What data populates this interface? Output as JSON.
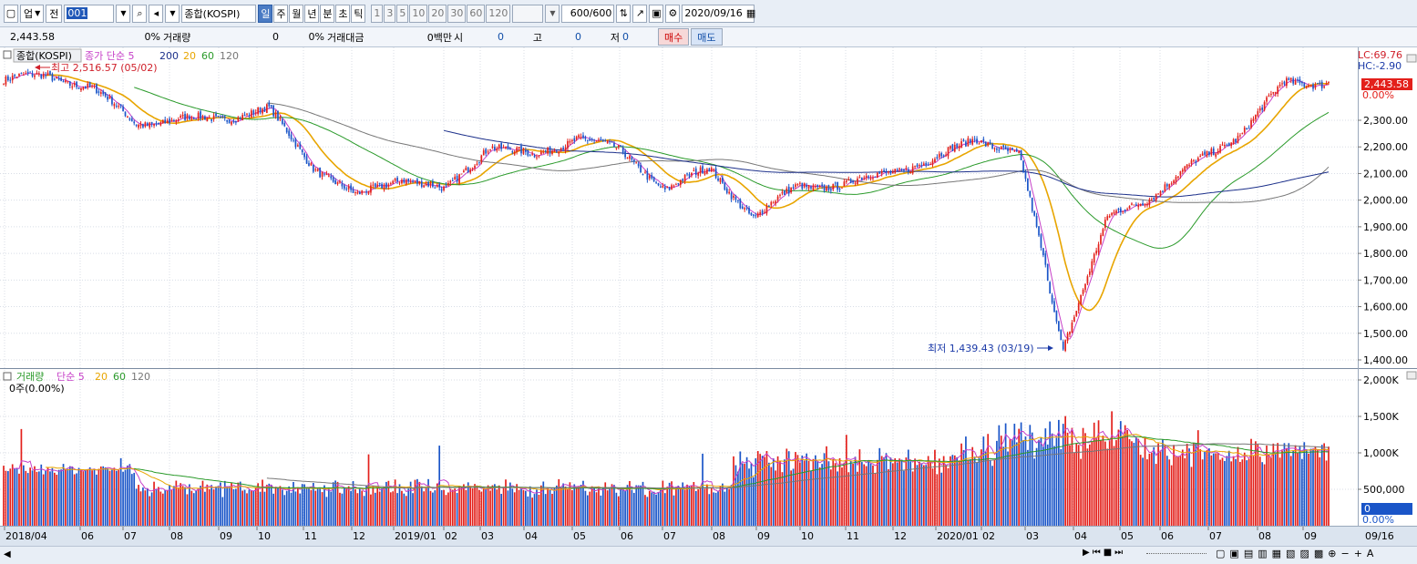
{
  "toolbar": {
    "market_label": "업",
    "prev_label": "전",
    "code_value": "001",
    "name_value": "종합(KOSPI)",
    "periods": [
      {
        "label": "일",
        "active": true
      },
      {
        "label": "주",
        "active": false
      },
      {
        "label": "월",
        "active": false
      },
      {
        "label": "년",
        "active": false
      },
      {
        "label": "분",
        "active": false
      },
      {
        "label": "초",
        "active": false
      },
      {
        "label": "틱",
        "active": false
      }
    ],
    "intervals": [
      "1",
      "3",
      "5",
      "10",
      "20",
      "30",
      "60",
      "120"
    ],
    "count_value": "600/600",
    "date_value": "2020/09/16"
  },
  "infobar": {
    "price": "2,443.58",
    "change_pct": "0%",
    "volume_label": "거래량",
    "volume_value": "0",
    "volume_pct": "0%",
    "amount_label": "거래대금",
    "amount_value": "0백만",
    "open_label": "시",
    "open_value": "0",
    "high_label": "고",
    "high_value": "0",
    "low_label": "저",
    "low_value": "0",
    "buy_label": "매수",
    "sell_label": "매도"
  },
  "colors": {
    "up": "#e3201b",
    "down": "#1a55c8",
    "ma5": "#c640c8",
    "ma20": "#e8a500",
    "ma60": "#2a9a2a",
    "ma120": "#777777",
    "ma200": "#1b2f8a",
    "volume_axis_box": "#1a55c8"
  },
  "price_panel": {
    "legend_title": "종합(KOSPI)",
    "legend_series": [
      {
        "text": "종가 단순 5",
        "color": "#c640c8"
      },
      {
        "text": "200",
        "color": "#1b2f8a"
      },
      {
        "text": "20",
        "color": "#e8a500"
      },
      {
        "text": "60",
        "color": "#2a9a2a"
      },
      {
        "text": "120",
        "color": "#777777"
      }
    ],
    "high_annotation": "최고 2,516.57 (05/02)",
    "low_annotation": "최저 1,439.43 (03/19)",
    "lc_label": "LC:69.76",
    "hc_label": "HC:-2.90",
    "current_price": "2,443.58",
    "current_pct": "0.00%",
    "y_ticks": [
      "2,300.00",
      "2,200.00",
      "2,100.00",
      "2,000.00",
      "1,900.00",
      "1,800.00",
      "1,700.00",
      "1,600.00",
      "1,500.00",
      "1,400.00"
    ]
  },
  "volume_panel": {
    "legend_title": "거래량",
    "legend_series": [
      {
        "text": "단순 5",
        "color": "#c640c8"
      },
      {
        "text": "20",
        "color": "#e8a500"
      },
      {
        "text": "60",
        "color": "#2a9a2a"
      },
      {
        "text": "120",
        "color": "#777777"
      }
    ],
    "sub_label": "0주(0.00%)",
    "y_ticks": [
      "2,000K",
      "1,500K",
      "1,000K",
      "500,000"
    ],
    "current_value": "0",
    "current_pct": "0.00%"
  },
  "x_axis_labels": [
    "2018/04",
    "06",
    "07",
    "08",
    "09",
    "10",
    "11",
    "12",
    "2019/01",
    "02",
    "03",
    "04",
    "05",
    "06",
    "07",
    "08",
    "09",
    "10",
    "11",
    "12",
    "2020/01",
    "02",
    "03",
    "04",
    "05",
    "06",
    "07",
    "08",
    "09",
    "09/16"
  ],
  "chart_data": {
    "type": "candlestick",
    "title": "종합(KOSPI)",
    "date_range": [
      "2018/04",
      "2020/09/16"
    ],
    "x_ticks": [
      "2018/04",
      "06",
      "07",
      "08",
      "09",
      "10",
      "11",
      "12",
      "2019/01",
      "02",
      "03",
      "04",
      "05",
      "06",
      "07",
      "08",
      "09",
      "10",
      "11",
      "12",
      "2020/01",
      "02",
      "03",
      "04",
      "05",
      "06",
      "07",
      "08",
      "09",
      "09/16"
    ],
    "ylim": [
      1400,
      2500
    ],
    "price_path": [
      {
        "date": "2018/04",
        "close": 2450
      },
      {
        "date": "2018/05",
        "close": 2470
      },
      {
        "date": "2018/06",
        "close": 2420
      },
      {
        "date": "2018/07",
        "close": 2290
      },
      {
        "date": "2018/08",
        "close": 2300
      },
      {
        "date": "2018/09",
        "close": 2310
      },
      {
        "date": "2018/10",
        "close": 2340
      },
      {
        "date": "2018/10b",
        "close": 2130
      },
      {
        "date": "2018/11",
        "close": 2010
      },
      {
        "date": "2018/12",
        "close": 2090
      },
      {
        "date": "2019/01",
        "close": 2030
      },
      {
        "date": "2019/02",
        "close": 2210
      },
      {
        "date": "2019/03",
        "close": 2160
      },
      {
        "date": "2019/04",
        "close": 2240
      },
      {
        "date": "2019/05",
        "close": 2180
      },
      {
        "date": "2019/06",
        "close": 2040
      },
      {
        "date": "2019/07",
        "close": 2120
      },
      {
        "date": "2019/08",
        "close": 1930
      },
      {
        "date": "2019/09",
        "close": 2060
      },
      {
        "date": "2019/10",
        "close": 2050
      },
      {
        "date": "2019/11",
        "close": 2110
      },
      {
        "date": "2019/12",
        "close": 2140
      },
      {
        "date": "2020/01",
        "close": 2240
      },
      {
        "date": "2020/02",
        "close": 2160
      },
      {
        "date": "2020/03",
        "close": 1460
      },
      {
        "date": "2020/04",
        "close": 1930
      },
      {
        "date": "2020/05",
        "close": 2020
      },
      {
        "date": "2020/06",
        "close": 2140
      },
      {
        "date": "2020/07",
        "close": 2250
      },
      {
        "date": "2020/08",
        "close": 2440
      },
      {
        "date": "2020/09/16",
        "close": 2443.58
      }
    ],
    "annotations": [
      {
        "text": "최고 2,516.57 (05/02)",
        "value": 2516.57
      },
      {
        "text": "최저 1,439.43 (03/19)",
        "value": 1439.43
      }
    ],
    "series": [
      {
        "name": "종가 단순 5"
      },
      {
        "name": "200"
      },
      {
        "name": "20"
      },
      {
        "name": "60"
      },
      {
        "name": "120"
      }
    ],
    "volume": {
      "ylim": [
        0,
        2000000
      ],
      "ticks": [
        "2,000K",
        "1,500K",
        "1,000K",
        "500,000"
      ]
    }
  }
}
